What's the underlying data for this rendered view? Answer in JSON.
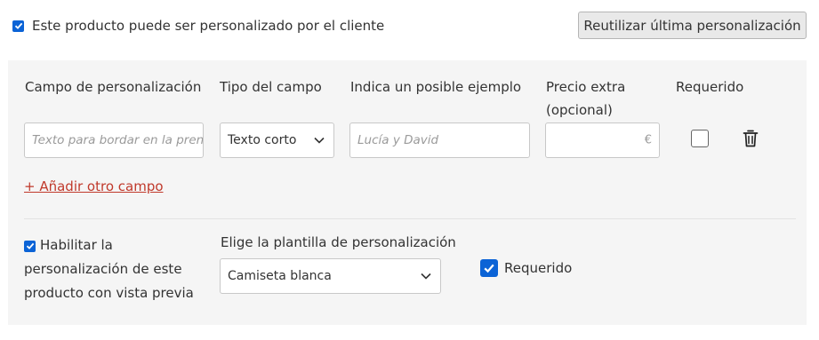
{
  "customizable": {
    "checked": true,
    "label": "Este producto puede ser personalizado por el cliente"
  },
  "reuse_button": "Reutilizar última personalización",
  "fields": {
    "headers": {
      "field": "Campo de personalización",
      "type": "Tipo del campo",
      "example": "Indica un posible ejemplo",
      "price": "Precio extra",
      "price_note": "(opcional)",
      "required": "Requerido"
    },
    "row": {
      "field_placeholder": "Texto para bordar en la prenda",
      "type_value": "Texto corto",
      "example_placeholder": "Lucía y David",
      "price_value": "",
      "currency": "€",
      "required": false
    },
    "add_link": "+ Añadir otro campo"
  },
  "preview": {
    "enabled": true,
    "label": "Habilitar la personalización de este producto con vista previa",
    "template_label": "Elige la plantilla de personalización",
    "template_value": "Camiseta blanca",
    "required_checked": true,
    "required_label": "Requerido"
  },
  "colors": {
    "accent": "#0b63d6",
    "link": "#c0392b",
    "panel_bg": "#f5f5f5"
  }
}
